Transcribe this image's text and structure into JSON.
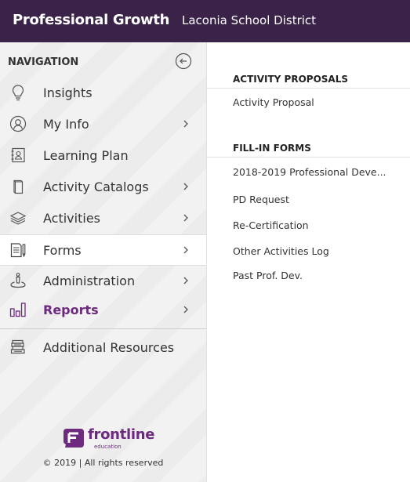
{
  "header": {
    "app_title": "Professional Growth",
    "district": "Laconia School District"
  },
  "sidebar": {
    "nav_header": "NAVIGATION",
    "items": [
      {
        "label": "Insights",
        "icon": "lightbulb-icon",
        "has_chevron": false
      },
      {
        "label": "My Info",
        "icon": "user-circle-icon",
        "has_chevron": true
      },
      {
        "label": "Learning Plan",
        "icon": "address-book-icon",
        "has_chevron": false
      },
      {
        "label": "Activity Catalogs",
        "icon": "catalog-icon",
        "has_chevron": true
      },
      {
        "label": "Activities",
        "icon": "layers-icon",
        "has_chevron": true
      },
      {
        "label": "Forms",
        "icon": "form-icon",
        "has_chevron": true,
        "active": true
      },
      {
        "label": "Administration",
        "icon": "administration-icon",
        "has_chevron": true
      },
      {
        "label": "Reports",
        "icon": "bar-chart-icon",
        "has_chevron": true
      },
      {
        "label": "Additional Resources",
        "icon": "books-icon",
        "has_chevron": false
      }
    ],
    "logo_text": "frontline",
    "logo_sub": "education",
    "copyright": "© 2019 | All rights reserved"
  },
  "main": {
    "sections": [
      {
        "heading": "ACTIVITY PROPOSALS",
        "links": [
          "Activity Proposal"
        ]
      },
      {
        "heading": "FILL-IN FORMS",
        "links": [
          "2018-2019 Professional Deve...",
          "PD Request",
          "Re-Certification",
          "Other Activities Log",
          "Past Prof. Dev."
        ]
      }
    ]
  },
  "colors": {
    "topbar": "#3a2249",
    "accent": "#6d2b7f",
    "sidebar_bg": "#f2f2f2"
  }
}
